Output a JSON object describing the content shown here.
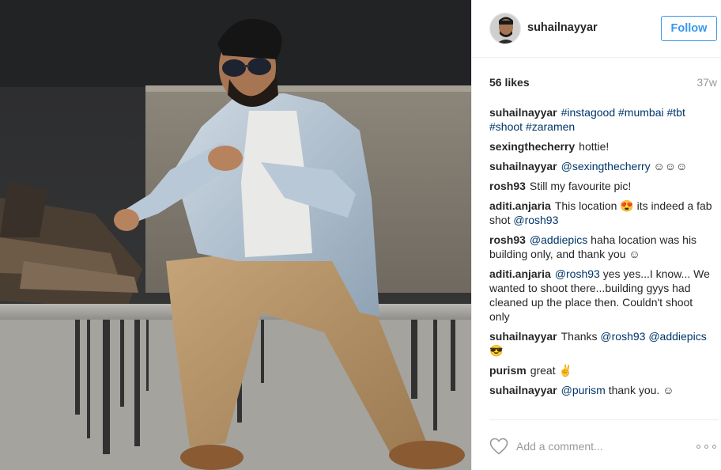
{
  "post": {
    "username": "suhailnayyar",
    "follow_label": "Follow",
    "likes": "56 likes",
    "age": "37w",
    "comment_placeholder": "Add a comment..."
  },
  "comments": [
    {
      "author": "suhailnayyar",
      "parts": [
        {
          "t": "#instagood",
          "link": true
        },
        {
          "t": " "
        },
        {
          "t": "#mumbai",
          "link": true
        },
        {
          "t": " "
        },
        {
          "t": "#tbt",
          "link": true
        },
        {
          "t": " "
        },
        {
          "t": "#shoot",
          "link": true
        },
        {
          "t": " "
        },
        {
          "t": "#zaramen",
          "link": true
        }
      ]
    },
    {
      "author": "sexingthecherry",
      "parts": [
        {
          "t": "hottie!"
        }
      ]
    },
    {
      "author": "suhailnayyar",
      "parts": [
        {
          "t": "@sexingthecherry",
          "link": true
        },
        {
          "t": " ☺☺☺"
        }
      ]
    },
    {
      "author": "rosh93",
      "parts": [
        {
          "t": "Still my favourite pic!"
        }
      ]
    },
    {
      "author": "aditi.anjaria",
      "parts": [
        {
          "t": "This location 😍 its indeed a fab shot "
        },
        {
          "t": "@rosh93",
          "link": true
        }
      ]
    },
    {
      "author": "rosh93",
      "parts": [
        {
          "t": "@addiepics",
          "link": true
        },
        {
          "t": " haha location was his building only, and thank you ☺"
        }
      ]
    },
    {
      "author": "aditi.anjaria",
      "parts": [
        {
          "t": "@rosh93",
          "link": true
        },
        {
          "t": " yes yes...I know... We wanted to shoot there...building gyys had cleaned up the place then. Couldn't shoot only"
        }
      ]
    },
    {
      "author": "suhailnayyar",
      "parts": [
        {
          "t": "Thanks "
        },
        {
          "t": "@rosh93",
          "link": true
        },
        {
          "t": " "
        },
        {
          "t": "@addiepics",
          "link": true
        },
        {
          "t": " 😎"
        }
      ]
    },
    {
      "author": "purism",
      "parts": [
        {
          "t": "great ✌"
        }
      ]
    },
    {
      "author": "suhailnayyar",
      "parts": [
        {
          "t": "@purism",
          "link": true
        },
        {
          "t": " thank you. ☺"
        }
      ]
    }
  ],
  "icons": {
    "like": "heart-outline-icon",
    "more": "more-options-icon"
  },
  "colors": {
    "follow_blue": "#3897f0",
    "link": "#003569",
    "muted": "#999999",
    "text": "#262626"
  }
}
